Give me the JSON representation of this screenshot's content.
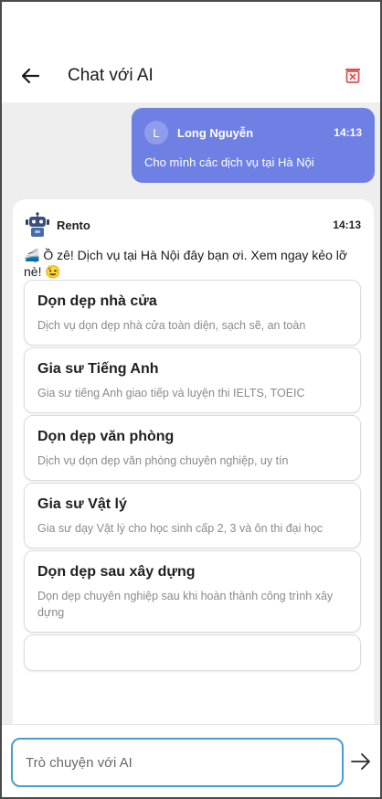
{
  "header": {
    "title": "Chat với AI"
  },
  "user_message": {
    "avatar_letter": "L",
    "name": "Long Nguyễn",
    "time": "14:13",
    "text": "Cho mình các dịch vụ tại Hà Nội"
  },
  "bot_message": {
    "name": "Rento",
    "time": "14:13",
    "text": "🚄 Ồ zê! Dịch vụ tại Hà Nội đây bạn ơi. Xem ngay kẻo lỡ nè! 😉",
    "services": [
      {
        "title": "Dọn dẹp nhà cửa",
        "description": "Dịch vụ dọn dẹp nhà cửa toàn diện, sạch sẽ, an toàn"
      },
      {
        "title": "Gia sư Tiếng Anh",
        "description": "Gia sư tiếng Anh giao tiếp và luyện thi IELTS, TOEIC"
      },
      {
        "title": "Dọn dẹp văn phòng",
        "description": "Dịch vụ dọn dẹp văn phòng chuyên nghiệp, uy tín"
      },
      {
        "title": "Gia sư Vật lý",
        "description": "Gia sư dạy Vật lý cho học sinh cấp 2, 3 và ôn thi đại học"
      },
      {
        "title": "Dọn dẹp sau xây dựng",
        "description": "Dọn dẹp chuyên nghiệp sau khi hoàn thành công trình xây dựng"
      }
    ]
  },
  "input": {
    "placeholder": "Trò chuyện với AI",
    "value": ""
  },
  "icons": {
    "back": "arrow-left-icon",
    "delete": "trash-icon",
    "bot_avatar": "robot-icon",
    "send": "arrow-right-icon"
  },
  "colors": {
    "user_bubble": "#6f80e5",
    "input_border": "#4a9bd1",
    "delete_icon": "#e05252",
    "chat_background": "#eeeeee"
  }
}
